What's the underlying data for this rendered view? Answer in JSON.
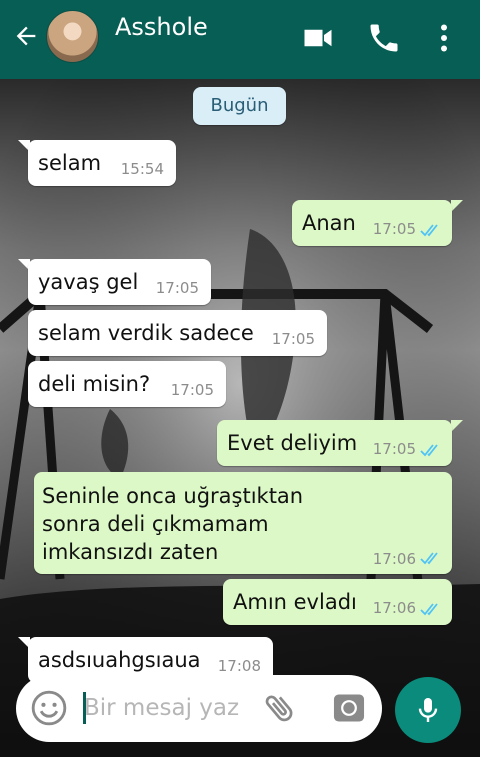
{
  "header": {
    "contact_name": "Asshole",
    "icons": [
      "back-arrow-icon",
      "video-call-icon",
      "phone-icon",
      "more-vert-icon"
    ]
  },
  "chat": {
    "date_label": "Bugün",
    "messages": [
      {
        "direction": "incoming",
        "text": "selam",
        "time": "15:54"
      },
      {
        "direction": "outgoing",
        "text": "Anan",
        "time": "17:05",
        "status": "read"
      },
      {
        "direction": "incoming",
        "text": "yavaş gel",
        "time": "17:05"
      },
      {
        "direction": "incoming",
        "text": "selam verdik sadece",
        "time": "17:05"
      },
      {
        "direction": "incoming",
        "text": "deli misin?",
        "time": "17:05"
      },
      {
        "direction": "outgoing",
        "text": "Evet deliyim",
        "time": "17:05",
        "status": "read"
      },
      {
        "direction": "outgoing",
        "text": "Seninle onca uğraştıktan sonra deli çıkmamam imkansızdı zaten",
        "time": "17:06",
        "status": "read"
      },
      {
        "direction": "outgoing",
        "text": "Amın evladı",
        "time": "17:06",
        "status": "read"
      },
      {
        "direction": "incoming",
        "text": "asdsıuahgsıaua",
        "time": "17:08"
      }
    ]
  },
  "composer": {
    "placeholder": "Bir mesaj yaz",
    "value": ""
  },
  "colors": {
    "header": "#075e54",
    "outgoing_bubble": "#dcf8c6",
    "incoming_bubble": "#ffffff",
    "read_ticks": "#4fc3f7",
    "mic_button": "#0a8b7b"
  }
}
